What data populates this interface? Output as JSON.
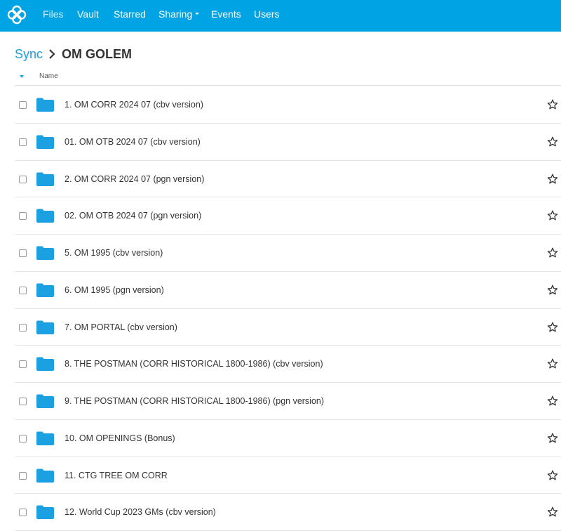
{
  "nav": {
    "items": [
      {
        "label": "Files",
        "active": true
      },
      {
        "label": "Vault"
      },
      {
        "label": "Starred"
      },
      {
        "label": "Sharing",
        "dropdown": true
      },
      {
        "label": "Events"
      },
      {
        "label": "Users"
      }
    ]
  },
  "breadcrumb": {
    "parent": "Sync",
    "current": "OM GOLEM"
  },
  "table": {
    "column_name": "Name",
    "rows": [
      {
        "name": "1. OM CORR 2024 07 (cbv version)"
      },
      {
        "name": "01. OM OTB 2024 07 (cbv version)"
      },
      {
        "name": "2. OM CORR 2024 07 (pgn version)"
      },
      {
        "name": "02. OM OTB 2024 07 (pgn version)"
      },
      {
        "name": "5. OM 1995 (cbv version)"
      },
      {
        "name": "6. OM 1995 (pgn version)"
      },
      {
        "name": "7. OM PORTAL (cbv version)"
      },
      {
        "name": "8. THE POSTMAN (CORR HISTORICAL 1800-1986) (cbv version)"
      },
      {
        "name": "9. THE POSTMAN (CORR HISTORICAL 1800-1986) (pgn version)"
      },
      {
        "name": "10. OM OPENINGS (Bonus)"
      },
      {
        "name": "11. CTG TREE OM CORR"
      },
      {
        "name": "12. World Cup 2023 GMs (cbv version)"
      }
    ]
  },
  "icons": {
    "logo": "sync-logo-icon",
    "folder": "folder-icon",
    "star": "star-outline-icon",
    "sort": "sort-descending-icon"
  },
  "colors": {
    "topbar": "#00a4e4",
    "link": "#1ba1e2",
    "folder": "#1ba1e2"
  }
}
